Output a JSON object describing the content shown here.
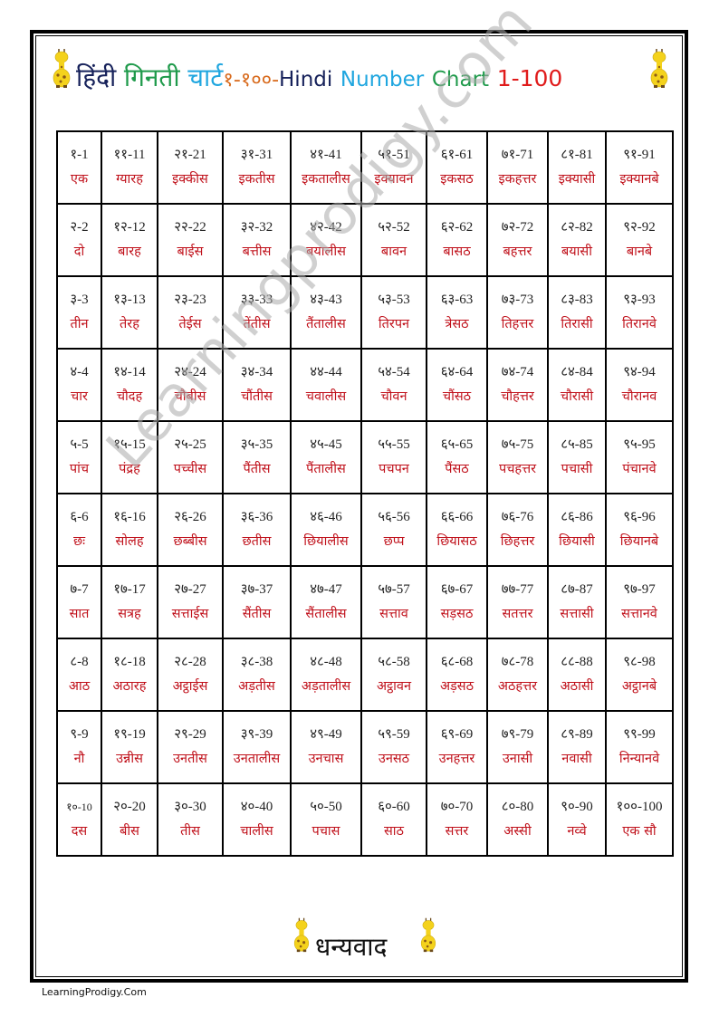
{
  "title": {
    "hindi": "हिंदी",
    "ginti": "गिनती",
    "chart": "चार्ट",
    "range_devanagari": "१-१००-",
    "english_hindi": "Hindi",
    "english_number": "Number",
    "english_chart": "Chart",
    "english_range": "1-100"
  },
  "icons": {
    "decoration": "giraffe-icon"
  },
  "colors": {
    "title_dark_blue": "#16215a",
    "title_green": "#1f9a4b",
    "title_light_blue": "#1fa6df",
    "title_orange": "#d86a1c",
    "title_red": "#e01b1b",
    "word_red": "#c0111b"
  },
  "rows": [
    [
      {
        "num": "१-1",
        "word": "एक"
      },
      {
        "num": "११-11",
        "word": "ग्यारह"
      },
      {
        "num": "२१-21",
        "word": "इक्कीस"
      },
      {
        "num": "३१-31",
        "word": "इकतीस"
      },
      {
        "num": "४१-41",
        "word": "इकतालीस"
      },
      {
        "num": "५१-51",
        "word": "इक्यावन"
      },
      {
        "num": "६१-61",
        "word": "इकसठ"
      },
      {
        "num": "७१-71",
        "word": "इकहत्तर"
      },
      {
        "num": "८१-81",
        "word": "इक्यासी"
      },
      {
        "num": "९१-91",
        "word": "इक्यानबे"
      }
    ],
    [
      {
        "num": "२-2",
        "word": "दो"
      },
      {
        "num": "१२-12",
        "word": "बारह"
      },
      {
        "num": "२२-22",
        "word": "बाईस"
      },
      {
        "num": "३२-32",
        "word": "बत्तीस"
      },
      {
        "num": "४२-42",
        "word": "बयालीस"
      },
      {
        "num": "५२-52",
        "word": "बावन"
      },
      {
        "num": "६२-62",
        "word": "बासठ"
      },
      {
        "num": "७२-72",
        "word": "बहत्तर"
      },
      {
        "num": "८२-82",
        "word": "बयासी"
      },
      {
        "num": "९२-92",
        "word": "बानबे"
      }
    ],
    [
      {
        "num": "३-3",
        "word": "तीन"
      },
      {
        "num": "१३-13",
        "word": "तेरह"
      },
      {
        "num": "२३-23",
        "word": "तेईस"
      },
      {
        "num": "३३-33",
        "word": "तेंतीस"
      },
      {
        "num": "४३-43",
        "word": "तैंतालीस"
      },
      {
        "num": "५३-53",
        "word": "तिरपन"
      },
      {
        "num": "६३-63",
        "word": "त्रेसठ"
      },
      {
        "num": "७३-73",
        "word": "तिहत्तर"
      },
      {
        "num": "८३-83",
        "word": "तिरासी"
      },
      {
        "num": "९३-93",
        "word": "तिरानवे"
      }
    ],
    [
      {
        "num": "४-4",
        "word": "चार"
      },
      {
        "num": "१४-14",
        "word": "चौदह"
      },
      {
        "num": "२४-24",
        "word": "चौबीस"
      },
      {
        "num": "३४-34",
        "word": "चौंतीस"
      },
      {
        "num": "४४-44",
        "word": "चवालीस"
      },
      {
        "num": "५४-54",
        "word": "चौवन"
      },
      {
        "num": "६४-64",
        "word": "चौंसठ"
      },
      {
        "num": "७४-74",
        "word": "चौहत्तर"
      },
      {
        "num": "८४-84",
        "word": "चौरासी"
      },
      {
        "num": "९४-94",
        "word": "चौरानव"
      }
    ],
    [
      {
        "num": "५-5",
        "word": "पांच"
      },
      {
        "num": "१५-15",
        "word": "पंद्रह"
      },
      {
        "num": "२५-25",
        "word": "पच्चीस"
      },
      {
        "num": "३५-35",
        "word": "पैंतीस"
      },
      {
        "num": "४५-45",
        "word": "पैंतालीस"
      },
      {
        "num": "५५-55",
        "word": "पचपन"
      },
      {
        "num": "६५-65",
        "word": "पैंसठ"
      },
      {
        "num": "७५-75",
        "word": "पचहत्तर"
      },
      {
        "num": "८५-85",
        "word": "पचासी"
      },
      {
        "num": "९५-95",
        "word": "पंचानवे"
      }
    ],
    [
      {
        "num": "६-6",
        "word": "छः"
      },
      {
        "num": "१६-16",
        "word": "सोलह"
      },
      {
        "num": "२६-26",
        "word": "छब्बीस"
      },
      {
        "num": "३६-36",
        "word": "छतीस"
      },
      {
        "num": "४६-46",
        "word": "छियालीस"
      },
      {
        "num": "५६-56",
        "word": "छप्प"
      },
      {
        "num": "६६-66",
        "word": "छियासठ"
      },
      {
        "num": "७६-76",
        "word": "छिहत्तर"
      },
      {
        "num": "८६-86",
        "word": "छियासी"
      },
      {
        "num": "९६-96",
        "word": "छियानबे"
      }
    ],
    [
      {
        "num": "७-7",
        "word": "सात"
      },
      {
        "num": "१७-17",
        "word": "सत्रह"
      },
      {
        "num": "२७-27",
        "word": "सत्ताईस"
      },
      {
        "num": "३७-37",
        "word": "सैंतीस"
      },
      {
        "num": "४७-47",
        "word": "सैंतालीस"
      },
      {
        "num": "५७-57",
        "word": "सत्ताव"
      },
      {
        "num": "६७-67",
        "word": "सड़सठ"
      },
      {
        "num": "७७-77",
        "word": "सतत्तर"
      },
      {
        "num": "८७-87",
        "word": "सत्तासी"
      },
      {
        "num": "९७-97",
        "word": "सत्तानवे"
      }
    ],
    [
      {
        "num": "८-8",
        "word": "आठ"
      },
      {
        "num": "१८-18",
        "word": "अठारह"
      },
      {
        "num": "२८-28",
        "word": "अट्ठाईस"
      },
      {
        "num": "३८-38",
        "word": "अड़तीस"
      },
      {
        "num": "४८-48",
        "word": "अड़तालीस"
      },
      {
        "num": "५८-58",
        "word": "अट्ठावन"
      },
      {
        "num": "६८-68",
        "word": "अड़सठ"
      },
      {
        "num": "७८-78",
        "word": "अठहत्तर"
      },
      {
        "num": "८८-88",
        "word": "अठासी"
      },
      {
        "num": "९८-98",
        "word": "अट्ठानबे"
      }
    ],
    [
      {
        "num": "९-9",
        "word": "नौ"
      },
      {
        "num": "१९-19",
        "word": "उन्नीस"
      },
      {
        "num": "२९-29",
        "word": "उनतीस"
      },
      {
        "num": "३९-39",
        "word": "उनतालीस"
      },
      {
        "num": "४९-49",
        "word": "उनचास"
      },
      {
        "num": "५९-59",
        "word": "उनसठ"
      },
      {
        "num": "६९-69",
        "word": "उनहत्तर"
      },
      {
        "num": "७९-79",
        "word": "उनासी"
      },
      {
        "num": "८९-89",
        "word": "नवासी"
      },
      {
        "num": "९९-99",
        "word": "निन्यानवे"
      }
    ],
    [
      {
        "num": "१०-10",
        "word": "दस"
      },
      {
        "num": "२०-20",
        "word": "बीस"
      },
      {
        "num": "३०-30",
        "word": "तीस"
      },
      {
        "num": "४०-40",
        "word": "चालीस"
      },
      {
        "num": "५०-50",
        "word": "पचास"
      },
      {
        "num": "६०-60",
        "word": "साठ"
      },
      {
        "num": "७०-70",
        "word": "सत्तर"
      },
      {
        "num": "८०-80",
        "word": "अस्सी"
      },
      {
        "num": "९०-90",
        "word": "नव्वे"
      },
      {
        "num": "१००-100",
        "word": "एक सौ"
      }
    ]
  ],
  "watermark": "Learningprodigy.com",
  "thanks": "धन्यवाद",
  "footer": "LearningProdigy.Com"
}
